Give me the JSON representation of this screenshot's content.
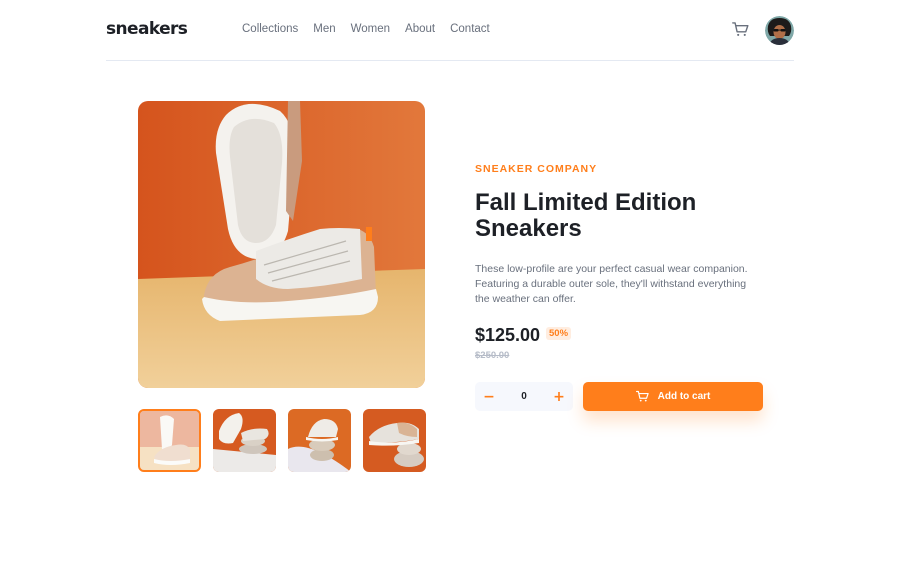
{
  "header": {
    "logo": "sneakers",
    "nav": [
      "Collections",
      "Men",
      "Women",
      "About",
      "Contact"
    ],
    "cart_icon": "cart-icon",
    "avatar_icon": "user-avatar"
  },
  "product": {
    "company": "SNEAKER COMPANY",
    "title": "Fall Limited Edition Sneakers",
    "description": "These low-profile are your perfect casual wear companion. Featuring a durable outer sole, they'll withstand everything the weather can offer.",
    "price": "$125.00",
    "discount": "50%",
    "old_price": "$250.00",
    "quantity": "0",
    "minus_label": "−",
    "plus_label": "+",
    "add_to_cart": "Add to cart"
  },
  "gallery": {
    "selected_index": 0,
    "thumbnail_count": 4
  },
  "colors": {
    "accent": "#ff7e1b",
    "accent_light": "#ffede0",
    "dark": "#1d2026",
    "grey": "#69707d",
    "light_grey": "#b6bcc8",
    "pale": "#f6f8fd"
  }
}
